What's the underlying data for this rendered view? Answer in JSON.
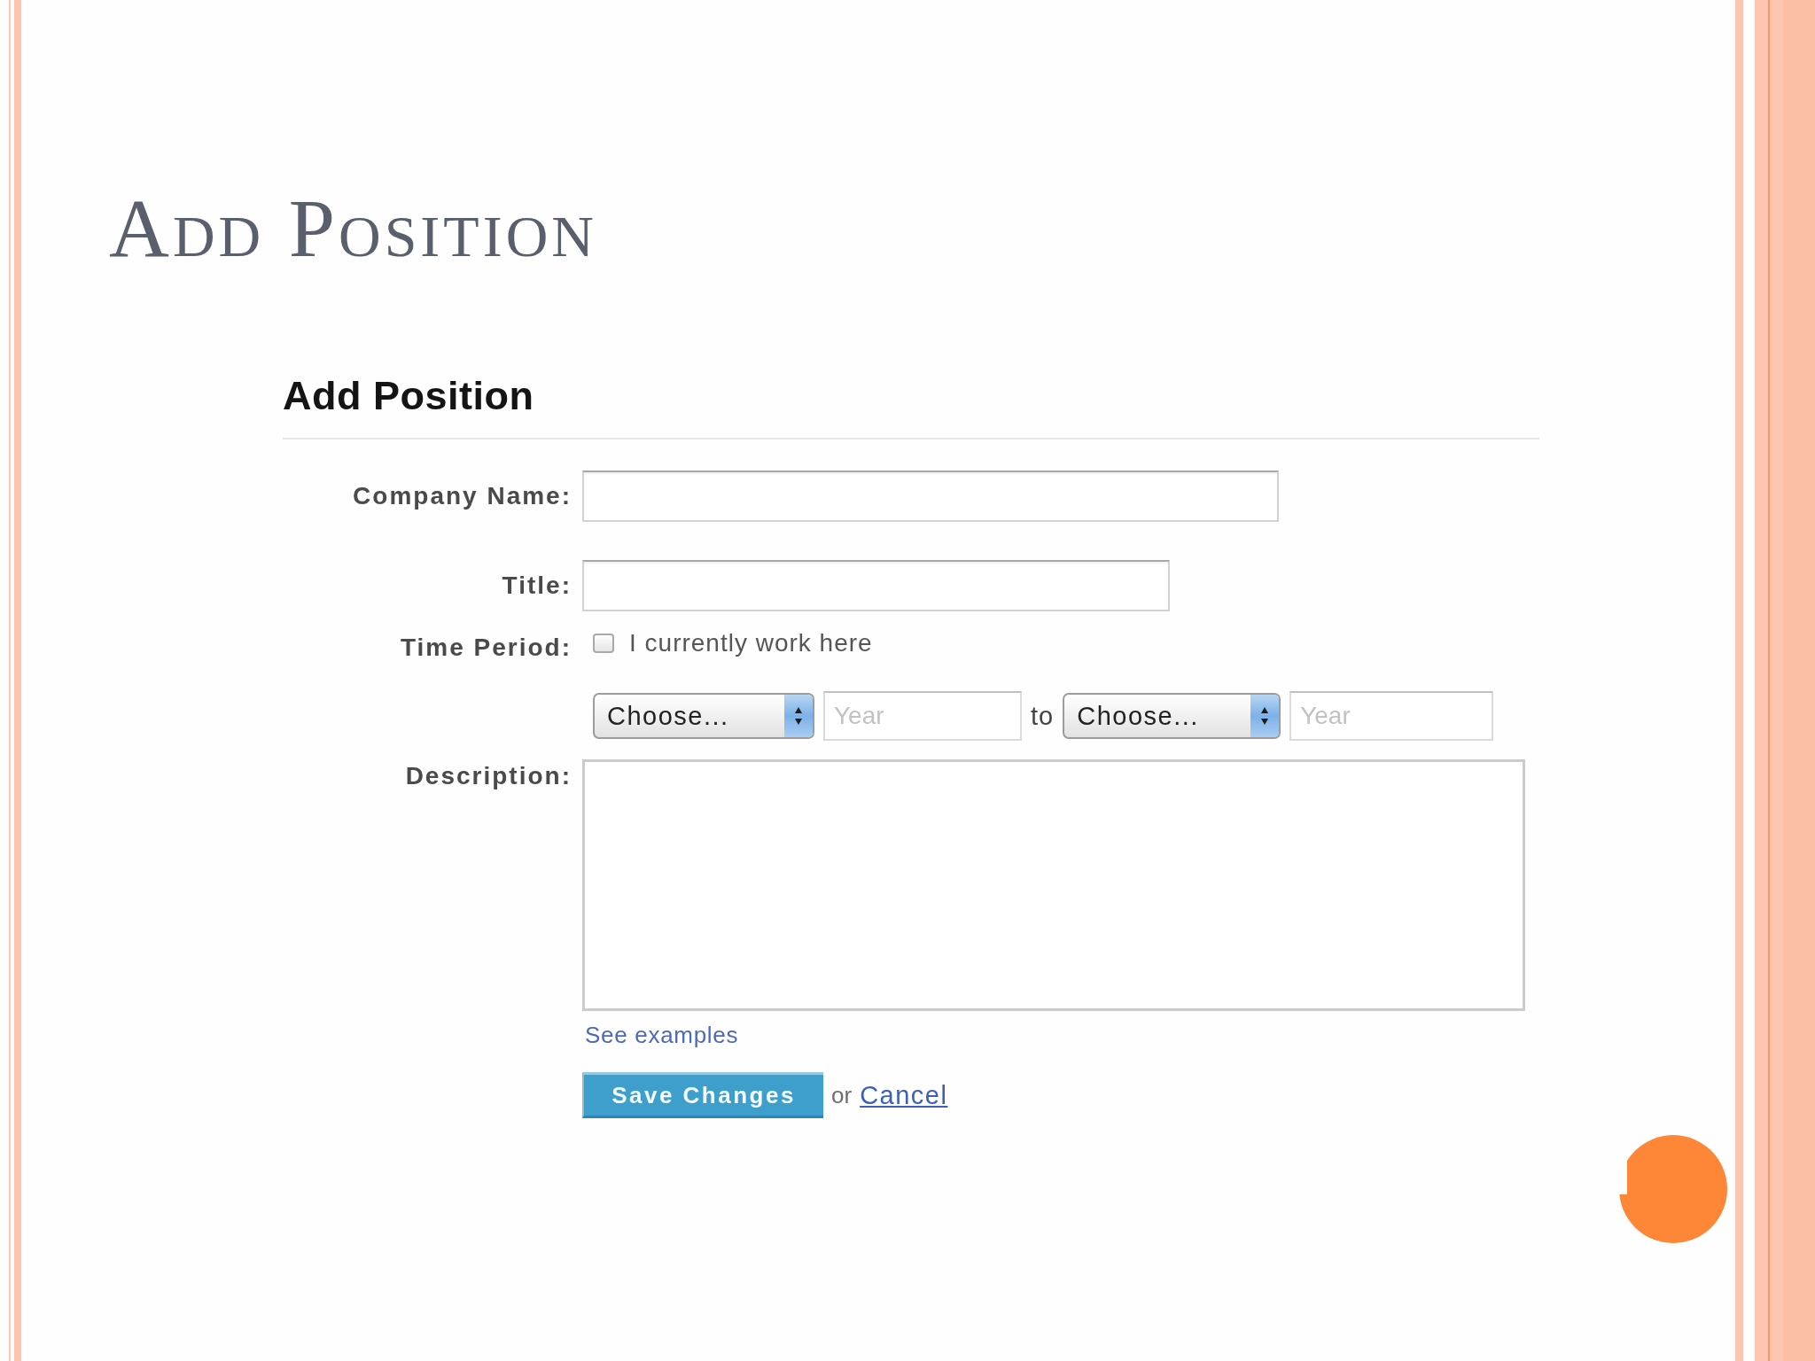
{
  "slide": {
    "title": "Add Position"
  },
  "form": {
    "heading": "Add Position",
    "fields": [
      {
        "kind": "text",
        "label": "Company Name:"
      },
      {
        "kind": "text",
        "label": "Title:"
      },
      {
        "kind": "period",
        "label": "Time Period:",
        "current": {
          "label": "I currently work here",
          "checked": false
        },
        "start": {
          "month": "Choose...",
          "year": {
            "placeholder": "Year"
          }
        },
        "separator": "to",
        "end": {
          "month": "Choose...",
          "year": {
            "placeholder": "Year"
          }
        }
      },
      {
        "kind": "textarea",
        "label": "Description:",
        "help_link": "See examples"
      }
    ],
    "actions": {
      "save": "Save Changes",
      "or": "or",
      "cancel": "Cancel"
    }
  }
}
